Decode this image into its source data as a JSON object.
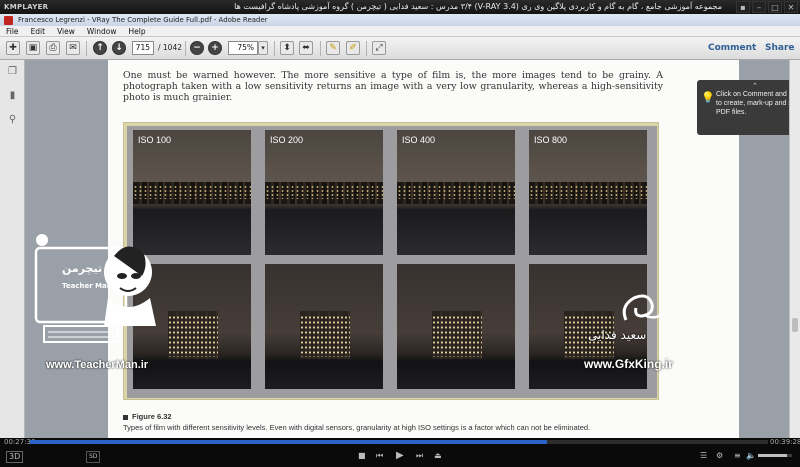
{
  "player": {
    "logo": "KMPLAYER",
    "caption": "مجموعه آموزشی جامع ، گام به گام و کاربردی پلاگین وی ری (V-RAY 3.4) ۳/۴ مدرس : سعید فدایی ( تیچرمن ) گروه آموزشی پادشاه گرافیست ها",
    "time_current": "00:27:38",
    "time_total": "00:39:28",
    "progress": 0.7,
    "volume": 0.85,
    "badge_3d": "3D",
    "badge_hd": "SD"
  },
  "reader": {
    "window_title": "Francesco Legrenzi - VRay The Complete Guide Full.pdf - Adobe Reader",
    "menu": [
      "File",
      "Edit",
      "View",
      "Window",
      "Help"
    ],
    "page_current": "715",
    "page_total": "/ 1042",
    "zoom": "75%",
    "comment_label": "Comment",
    "share_label": "Share",
    "tooltip": "Click on Comment and Share to create, mark-up and send PDF files."
  },
  "page": {
    "paragraph": "One must be warned however. The more sensitive a type of film is, the more images tend to be grainy. A photograph taken with a low sensitivity returns an image with a very low granularity, whereas a high-sensitivity photo is much grainier.",
    "photo_labels": [
      "ISO 100",
      "ISO 200",
      "ISO 400",
      "ISO 800"
    ],
    "figure_title": "Figure 6.32",
    "figure_text": "Types of film with different sensitivity levels. Even with digital sensors, granularity at high ISO settings is a factor which can not be eliminated."
  },
  "watermarks": {
    "left_url": "www.TeacherMan.ir",
    "left_badge": "تیچرمن",
    "left_name": "Teacher Man",
    "right_url": "www.GfxKing.ir",
    "right_name": "سعید فدایی"
  },
  "colors": {
    "accent": "#2a64c8",
    "reader_link": "#2f5f95",
    "figure_frame": "#dad4a7"
  }
}
